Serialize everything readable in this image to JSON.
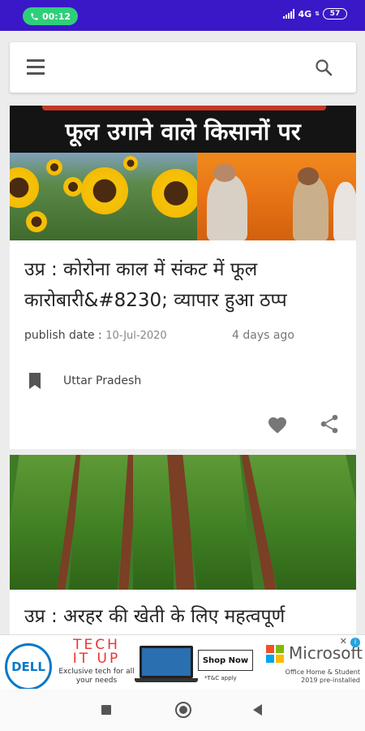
{
  "status_bar": {
    "time": "00:12",
    "network": "4G",
    "battery": "57"
  },
  "header": {
    "menu_icon": "hamburger-menu-icon",
    "search_icon": "search-icon"
  },
  "articles": [
    {
      "image_banner_text": "फूल उगाने वाले किसानों पर",
      "title": "उप्र : कोरोना काल में संकट में फूल कारोबारी&#8230; व्यापार हुआ ठप्प",
      "publish_label": "publish date : ",
      "publish_date": "10-Jul-2020",
      "time_ago": "4 days ago",
      "category": "Uttar Pradesh",
      "bookmark_icon": "bookmark-icon",
      "like_icon": "heart-icon",
      "share_icon": "share-icon"
    },
    {
      "title": "उप्र : अरहर की खेती के लिए महत्वपूर्ण"
    }
  ],
  "ad": {
    "brand_left": "DELL",
    "headline_1": "TECH",
    "headline_2": "IT UP",
    "copy": "Exclusive tech for all your needs",
    "cta": "Shop Now",
    "terms": "*T&C apply",
    "brand_right": "Microsoft",
    "subcopy": "Office Home & Student 2019 pre-installed",
    "colors": {
      "dell_blue": "#0a78c8",
      "tech_red": "#e33333"
    }
  },
  "colors": {
    "status_bar": "#3a18c8",
    "call_pill": "#2fcf7a"
  }
}
